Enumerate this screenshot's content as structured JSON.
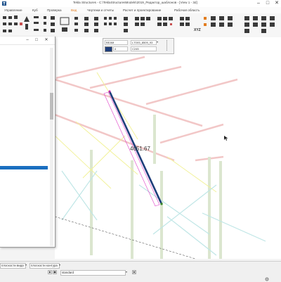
{
  "window": {
    "title": "Tekla Structures - C:\\TeklaStructuresModels\\2019_Редактор_шаблонов - [View 1 - 3d]",
    "minimize": "–",
    "maximize": "□",
    "close": "✕"
  },
  "menu": {
    "items": [
      "Управление",
      "Куб",
      "Проверка",
      "Вид",
      "Чертежи и отчеты",
      "Расчет и проектирование",
      "Рабочая область"
    ],
    "active": "Вид"
  },
  "colors": {
    "accent": "#e27c1f",
    "selection": "#1a6fc0",
    "beam": "#1e3d7a",
    "highlight": "#e040c8"
  },
  "ribbon": {
    "icons": [
      "select-icon",
      "snap-icon",
      "beam-icon",
      "column-icon",
      "plate-icon",
      "bolt-icon",
      "weld-icon",
      "cut-icon",
      "copy-icon",
      "move-icon",
      "grid-icon",
      "view-icon",
      "xyz-icon",
      "camera-icon",
      "settings-icon"
    ],
    "xyz_label": "XYZ"
  },
  "float_toolbar": {
    "type": "BEAM",
    "profile": "L70X5_8509_93",
    "class": "4",
    "material": "C245"
  },
  "viewport": {
    "dimension": "4651.67"
  },
  "panel": {
    "minimize": "–",
    "maximize": "□",
    "close": "✕"
  },
  "statusbar": {
    "view_plane": "плоскости вида",
    "contour_plane": "плоскости контура",
    "standard": "standard"
  }
}
